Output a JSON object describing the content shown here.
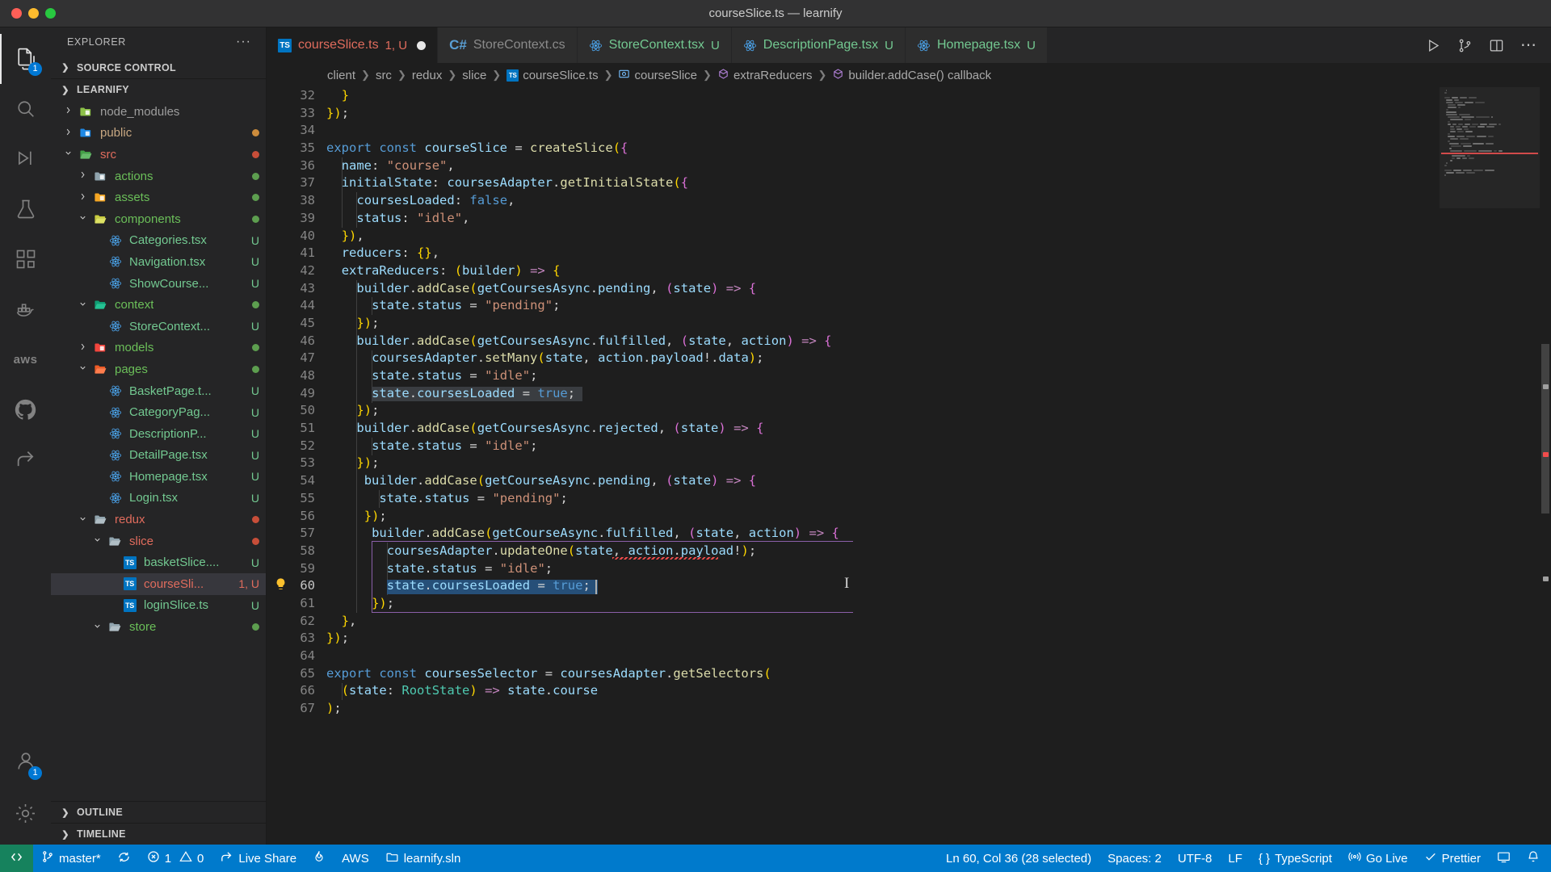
{
  "window": {
    "title": "courseSlice.ts — learnify"
  },
  "activitybar": {
    "items": [
      {
        "name": "explorer",
        "icon": "files-icon",
        "badge": "1",
        "active": true
      },
      {
        "name": "search",
        "icon": "search-icon",
        "badge": "",
        "active": false
      },
      {
        "name": "run-and-debug",
        "icon": "debug-icon",
        "badge": "",
        "active": false
      },
      {
        "name": "test",
        "icon": "beaker-icon",
        "badge": "",
        "active": false
      },
      {
        "name": "extensions",
        "icon": "extensions-icon",
        "badge": "",
        "active": false
      },
      {
        "name": "docker",
        "icon": "docker-icon",
        "badge": "",
        "active": false
      },
      {
        "name": "aws",
        "icon": "aws-icon",
        "badge": "",
        "active": false
      },
      {
        "name": "github",
        "icon": "github-icon",
        "badge": "",
        "active": false
      },
      {
        "name": "live-share",
        "icon": "live-share-icon",
        "badge": "",
        "active": false
      }
    ],
    "bottom": [
      {
        "name": "accounts",
        "icon": "account-icon",
        "badge": "1"
      },
      {
        "name": "manage",
        "icon": "gear-icon",
        "badge": ""
      }
    ]
  },
  "sidebar": {
    "header": "EXPLORER",
    "more_label": "···",
    "sections": [
      {
        "label": "SOURCE CONTROL",
        "expanded": false
      },
      {
        "label": "LEARNIFY",
        "expanded": true
      },
      {
        "label": "OUTLINE",
        "expanded": false
      },
      {
        "label": "TIMELINE",
        "expanded": false
      }
    ],
    "tree": [
      {
        "label": "node_modules",
        "kind": "folder",
        "depth": 1,
        "chevron": "closed",
        "color": "#9d9d9d",
        "icon": "folder-node-icon",
        "status": "",
        "dot": ""
      },
      {
        "label": "public",
        "kind": "folder",
        "depth": 1,
        "chevron": "closed",
        "color": "#c8a882",
        "icon": "folder-public-icon",
        "status": "",
        "dot": "#cc8c3c"
      },
      {
        "label": "src",
        "kind": "folder",
        "depth": 1,
        "chevron": "open",
        "color": "#e06c5d",
        "icon": "folder-src-icon",
        "status": "",
        "dot": "#c74e39"
      },
      {
        "label": "actions",
        "kind": "folder",
        "depth": 2,
        "chevron": "closed",
        "color": "#6bbf59",
        "icon": "folder-plain-icon",
        "status": "",
        "dot": "#5d9e4f"
      },
      {
        "label": "assets",
        "kind": "folder",
        "depth": 2,
        "chevron": "closed",
        "color": "#6bbf59",
        "icon": "folder-assets-icon",
        "status": "",
        "dot": "#5d9e4f"
      },
      {
        "label": "components",
        "kind": "folder",
        "depth": 2,
        "chevron": "open",
        "color": "#6bbf59",
        "icon": "folder-components-icon",
        "status": "",
        "dot": "#5d9e4f"
      },
      {
        "label": "Categories.tsx",
        "kind": "file",
        "depth": 3,
        "chevron": "",
        "color": "#73c991",
        "icon": "react-icon",
        "status": "U",
        "dot": ""
      },
      {
        "label": "Navigation.tsx",
        "kind": "file",
        "depth": 3,
        "chevron": "",
        "color": "#73c991",
        "icon": "react-icon",
        "status": "U",
        "dot": ""
      },
      {
        "label": "ShowCourse...",
        "kind": "file",
        "depth": 3,
        "chevron": "",
        "color": "#73c991",
        "icon": "react-icon",
        "status": "U",
        "dot": ""
      },
      {
        "label": "context",
        "kind": "folder",
        "depth": 2,
        "chevron": "open",
        "color": "#6bbf59",
        "icon": "folder-context-icon",
        "status": "",
        "dot": "#5d9e4f"
      },
      {
        "label": "StoreContext...",
        "kind": "file",
        "depth": 3,
        "chevron": "",
        "color": "#73c991",
        "icon": "react-icon",
        "status": "U",
        "dot": ""
      },
      {
        "label": "models",
        "kind": "folder",
        "depth": 2,
        "chevron": "closed",
        "color": "#6bbf59",
        "icon": "folder-models-icon",
        "status": "",
        "dot": "#5d9e4f"
      },
      {
        "label": "pages",
        "kind": "folder",
        "depth": 2,
        "chevron": "open",
        "color": "#6bbf59",
        "icon": "folder-pages-icon",
        "status": "",
        "dot": "#5d9e4f"
      },
      {
        "label": "BasketPage.t...",
        "kind": "file",
        "depth": 3,
        "chevron": "",
        "color": "#73c991",
        "icon": "react-icon",
        "status": "U",
        "dot": ""
      },
      {
        "label": "CategoryPag...",
        "kind": "file",
        "depth": 3,
        "chevron": "",
        "color": "#73c991",
        "icon": "react-icon",
        "status": "U",
        "dot": ""
      },
      {
        "label": "DescriptionP...",
        "kind": "file",
        "depth": 3,
        "chevron": "",
        "color": "#73c991",
        "icon": "react-icon",
        "status": "U",
        "dot": ""
      },
      {
        "label": "DetailPage.tsx",
        "kind": "file",
        "depth": 3,
        "chevron": "",
        "color": "#73c991",
        "icon": "react-icon",
        "status": "U",
        "dot": ""
      },
      {
        "label": "Homepage.tsx",
        "kind": "file",
        "depth": 3,
        "chevron": "",
        "color": "#73c991",
        "icon": "react-icon",
        "status": "U",
        "dot": ""
      },
      {
        "label": "Login.tsx",
        "kind": "file",
        "depth": 3,
        "chevron": "",
        "color": "#73c991",
        "icon": "react-icon",
        "status": "U",
        "dot": ""
      },
      {
        "label": "redux",
        "kind": "folder",
        "depth": 2,
        "chevron": "open",
        "color": "#e06c5d",
        "icon": "folder-plain-icon",
        "status": "",
        "dot": "#c74e39"
      },
      {
        "label": "slice",
        "kind": "folder",
        "depth": 3,
        "chevron": "open",
        "color": "#e06c5d",
        "icon": "folder-plain-icon",
        "status": "",
        "dot": "#c74e39"
      },
      {
        "label": "basketSlice....",
        "kind": "file",
        "depth": 4,
        "chevron": "",
        "color": "#73c991",
        "icon": "ts-icon",
        "status": "U",
        "dot": ""
      },
      {
        "label": "courseSli...",
        "kind": "file",
        "depth": 4,
        "chevron": "",
        "color": "#e06c5d",
        "icon": "ts-icon",
        "status": "1, U",
        "dot": "",
        "selected": true
      },
      {
        "label": "loginSlice.ts",
        "kind": "file",
        "depth": 4,
        "chevron": "",
        "color": "#73c991",
        "icon": "ts-icon",
        "status": "U",
        "dot": ""
      },
      {
        "label": "store",
        "kind": "folder",
        "depth": 3,
        "chevron": "open",
        "color": "#6bbf59",
        "icon": "folder-plain-icon",
        "status": "",
        "dot": "#5d9e4f"
      }
    ]
  },
  "tabs": [
    {
      "label": "courseSlice.ts",
      "status": "1, U",
      "icon": "ts-icon",
      "active": true,
      "dirty": true,
      "color": "#e06c5d"
    },
    {
      "label": "StoreContext.cs",
      "status": "",
      "icon": "csharp-icon",
      "active": false,
      "dirty": false,
      "color": "#8a8a8a"
    },
    {
      "label": "StoreContext.tsx",
      "status": "U",
      "icon": "react-icon",
      "active": false,
      "dirty": false,
      "color": "#73c991"
    },
    {
      "label": "DescriptionPage.tsx",
      "status": "U",
      "icon": "react-icon",
      "active": false,
      "dirty": false,
      "color": "#73c991"
    },
    {
      "label": "Homepage.tsx",
      "status": "U",
      "icon": "react-icon",
      "active": false,
      "dirty": false,
      "color": "#73c991"
    }
  ],
  "tab_actions": [
    {
      "name": "run-code-button",
      "icon": "play-icon"
    },
    {
      "name": "source-control-button",
      "icon": "branch-icon"
    },
    {
      "name": "split-editor-button",
      "icon": "split-icon"
    },
    {
      "name": "more-actions-button",
      "icon": "ellipsis-icon"
    }
  ],
  "breadcrumb": [
    {
      "label": "client",
      "icon": ""
    },
    {
      "label": "src",
      "icon": ""
    },
    {
      "label": "redux",
      "icon": ""
    },
    {
      "label": "slice",
      "icon": ""
    },
    {
      "label": "courseSlice.ts",
      "icon": "ts-icon"
    },
    {
      "label": "courseSlice",
      "icon": "variable-icon"
    },
    {
      "label": "extraReducers",
      "icon": "property-icon"
    },
    {
      "label": "builder.addCase() callback",
      "icon": "property-icon"
    }
  ],
  "editor": {
    "first_line": 32,
    "cursor_line": 60,
    "lines": [
      {
        "n": 32,
        "text": "  }"
      },
      {
        "n": 33,
        "text": "});"
      },
      {
        "n": 34,
        "text": ""
      },
      {
        "n": 35,
        "text": "export const courseSlice = createSlice({"
      },
      {
        "n": 36,
        "text": "  name: \"course\","
      },
      {
        "n": 37,
        "text": "  initialState: coursesAdapter.getInitialState({"
      },
      {
        "n": 38,
        "text": "    coursesLoaded: false,"
      },
      {
        "n": 39,
        "text": "    status: \"idle\","
      },
      {
        "n": 40,
        "text": "  }),"
      },
      {
        "n": 41,
        "text": "  reducers: {},"
      },
      {
        "n": 42,
        "text": "  extraReducers: (builder) => {"
      },
      {
        "n": 43,
        "text": "    builder.addCase(getCoursesAsync.pending, (state) => {"
      },
      {
        "n": 44,
        "text": "      state.status = \"pending\";"
      },
      {
        "n": 45,
        "text": "    });"
      },
      {
        "n": 46,
        "text": "    builder.addCase(getCoursesAsync.fulfilled, (state, action) => {"
      },
      {
        "n": 47,
        "text": "      coursesAdapter.setMany(state, action.payload!.data);"
      },
      {
        "n": 48,
        "text": "      state.status = \"idle\";"
      },
      {
        "n": 49,
        "text": "      state.coursesLoaded = true;"
      },
      {
        "n": 50,
        "text": "    });"
      },
      {
        "n": 51,
        "text": "    builder.addCase(getCoursesAsync.rejected, (state) => {"
      },
      {
        "n": 52,
        "text": "      state.status = \"idle\";"
      },
      {
        "n": 53,
        "text": "    });"
      },
      {
        "n": 54,
        "text": "     builder.addCase(getCourseAsync.pending, (state) => {"
      },
      {
        "n": 55,
        "text": "       state.status = \"pending\";"
      },
      {
        "n": 56,
        "text": "     });"
      },
      {
        "n": 57,
        "text": "      builder.addCase(getCourseAsync.fulfilled, (state, action) => {"
      },
      {
        "n": 58,
        "text": "        coursesAdapter.updateOne(state, action.payload!);"
      },
      {
        "n": 59,
        "text": "        state.status = \"idle\";"
      },
      {
        "n": 60,
        "text": "        state.coursesLoaded = true;"
      },
      {
        "n": 61,
        "text": "      });"
      },
      {
        "n": 62,
        "text": "  },"
      },
      {
        "n": 63,
        "text": "});"
      },
      {
        "n": 64,
        "text": ""
      },
      {
        "n": 65,
        "text": "export const coursesSelector = coursesAdapter.getSelectors("
      },
      {
        "n": 66,
        "text": "  (state: RootState) => state.course"
      },
      {
        "n": 67,
        "text": ");"
      }
    ],
    "lightbulb_line": 60
  },
  "statusbar": {
    "left": [
      {
        "name": "remote-indicator",
        "label": "",
        "icon": "remote-icon"
      },
      {
        "name": "branch-status",
        "label": "master*",
        "icon": "branch-icon"
      },
      {
        "name": "sync-status",
        "label": "",
        "icon": "sync-icon"
      },
      {
        "name": "problems-status",
        "label": "1",
        "label2": "0",
        "icon": "error-icon"
      },
      {
        "name": "live-share-status",
        "label": "Live Share",
        "icon": "live-share-icon"
      },
      {
        "name": "flame-status",
        "label": "",
        "icon": "flame-icon"
      },
      {
        "name": "aws-status",
        "label": "AWS",
        "icon": ""
      },
      {
        "name": "solution-status",
        "label": "learnify.sln",
        "icon": "folder-icon"
      }
    ],
    "right": [
      {
        "name": "cursor-position",
        "label": "Ln 60, Col 36 (28 selected)"
      },
      {
        "name": "indentation",
        "label": "Spaces: 2"
      },
      {
        "name": "encoding",
        "label": "UTF-8"
      },
      {
        "name": "eol",
        "label": "LF"
      },
      {
        "name": "language-mode",
        "label": "TypeScript",
        "icon": "braces-icon"
      },
      {
        "name": "go-live",
        "label": "Go Live",
        "icon": "broadcast-icon"
      },
      {
        "name": "prettier",
        "label": "Prettier",
        "icon": "check-icon"
      },
      {
        "name": "editor-actions",
        "label": "",
        "icon": "screen-icon"
      },
      {
        "name": "notifications",
        "label": "",
        "icon": "bell-icon"
      }
    ]
  },
  "colors": {
    "accent": "#007acc",
    "remote_green": "#16825d",
    "selection": "#264f78",
    "bracket_match": "#8a5fa8",
    "error": "#f14c4c"
  }
}
